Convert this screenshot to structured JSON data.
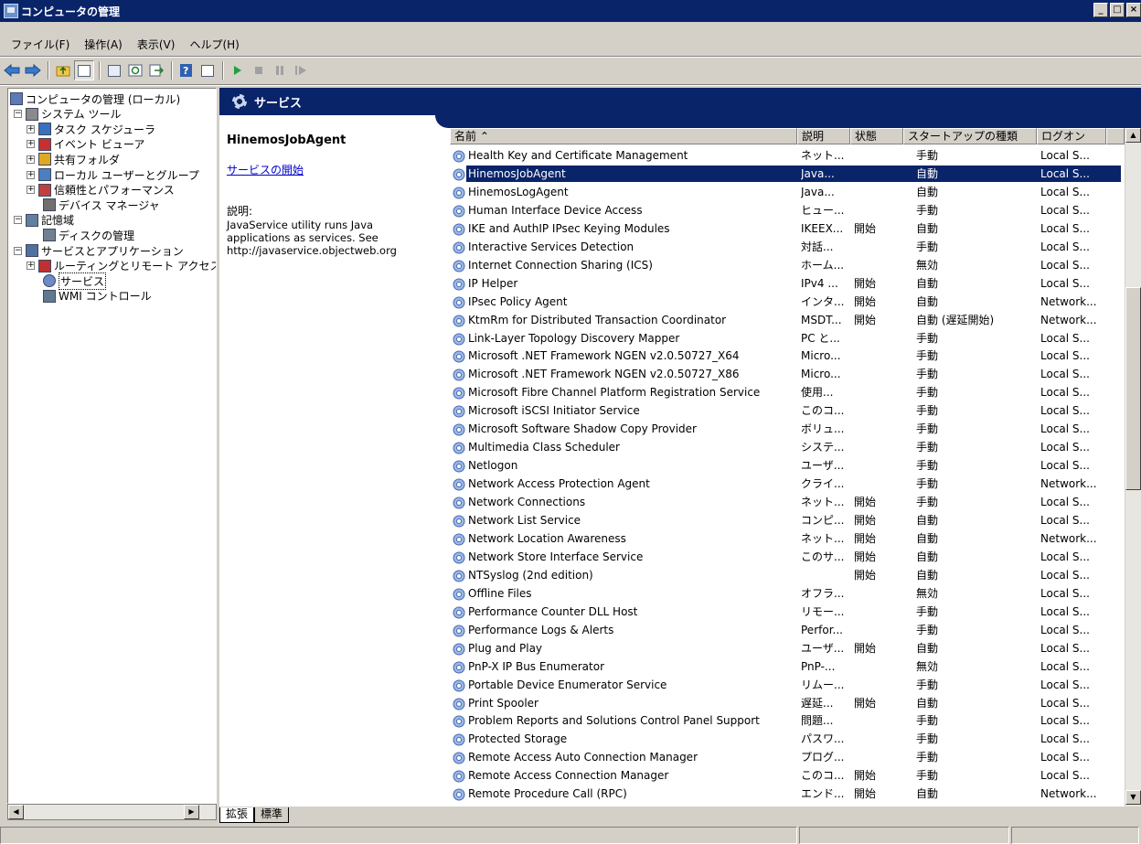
{
  "window": {
    "title": "コンピュータの管理"
  },
  "menu": [
    "ファイル(F)",
    "操作(A)",
    "表示(V)",
    "ヘルプ(H)"
  ],
  "tree": [
    {
      "label": "コンピュータの管理 (ローカル)",
      "level": 0,
      "expander": "",
      "icon": "computer-management-icon"
    },
    {
      "label": "システム ツール",
      "level": 1,
      "expander": "⊟",
      "icon": "tools-icon"
    },
    {
      "label": "タスク スケジューラ",
      "level": 2,
      "expander": "⊞",
      "icon": "clock-icon"
    },
    {
      "label": "イベント ビューア",
      "level": 2,
      "expander": "⊞",
      "icon": "event-viewer-icon"
    },
    {
      "label": "共有フォルダ",
      "level": 2,
      "expander": "⊞",
      "icon": "shared-folder-icon"
    },
    {
      "label": "ローカル ユーザーとグループ",
      "level": 2,
      "expander": "⊞",
      "icon": "users-icon"
    },
    {
      "label": "信頼性とパフォーマンス",
      "level": 2,
      "expander": "⊞",
      "icon": "performance-icon"
    },
    {
      "label": "デバイス マネージャ",
      "level": 3,
      "expander": "",
      "icon": "device-manager-icon"
    },
    {
      "label": "記憶域",
      "level": 1,
      "expander": "⊟",
      "icon": "storage-icon"
    },
    {
      "label": "ディスクの管理",
      "level": 3,
      "expander": "",
      "icon": "disk-icon"
    },
    {
      "label": "サービスとアプリケーション",
      "level": 1,
      "expander": "⊟",
      "icon": "services-apps-icon"
    },
    {
      "label": "ルーティングとリモート アクセス",
      "level": 2,
      "expander": "⊞",
      "icon": "routing-icon"
    },
    {
      "label": "サービス",
      "level": 3,
      "expander": "",
      "icon": "gear-icon",
      "selected": true
    },
    {
      "label": "WMI コントロール",
      "level": 3,
      "expander": "",
      "icon": "wmi-icon"
    }
  ],
  "header": {
    "title": "サービス"
  },
  "detail": {
    "name": "HinemosJobAgent",
    "start_link": "サービスの開始",
    "desc_label": "説明:",
    "desc_text": "JavaService utility runs Java applications as services. See http://javaservice.objectweb.org"
  },
  "columns": [
    "名前 ⌃",
    "説明",
    "状態",
    "スタートアップの種類",
    "ログオン"
  ],
  "services": [
    [
      "Health Key and Certificate Management",
      "ネット...",
      "",
      "手動",
      "Local S..."
    ],
    [
      "HinemosJobAgent",
      "Java...",
      "",
      "自動",
      "Local S..."
    ],
    [
      "HinemosLogAgent",
      "Java...",
      "",
      "自動",
      "Local S..."
    ],
    [
      "Human Interface Device Access",
      "ヒュー...",
      "",
      "手動",
      "Local S..."
    ],
    [
      "IKE and AuthIP IPsec Keying Modules",
      "IKEEX...",
      "開始",
      "自動",
      "Local S..."
    ],
    [
      "Interactive Services Detection",
      "対話...",
      "",
      "手動",
      "Local S..."
    ],
    [
      "Internet Connection Sharing (ICS)",
      "ホーム...",
      "",
      "無効",
      "Local S..."
    ],
    [
      "IP Helper",
      "IPv4 ...",
      "開始",
      "自動",
      "Local S..."
    ],
    [
      "IPsec Policy Agent",
      "インタ...",
      "開始",
      "自動",
      "Network..."
    ],
    [
      "KtmRm for Distributed Transaction Coordinator",
      "MSDT...",
      "開始",
      "自動 (遅延開始)",
      "Network..."
    ],
    [
      "Link-Layer Topology Discovery Mapper",
      "PC と...",
      "",
      "手動",
      "Local S..."
    ],
    [
      "Microsoft .NET Framework NGEN v2.0.50727_X64",
      "Micro...",
      "",
      "手動",
      "Local S..."
    ],
    [
      "Microsoft .NET Framework NGEN v2.0.50727_X86",
      "Micro...",
      "",
      "手動",
      "Local S..."
    ],
    [
      "Microsoft Fibre Channel Platform Registration Service",
      "使用...",
      "",
      "手動",
      "Local S..."
    ],
    [
      "Microsoft iSCSI Initiator Service",
      "このコ...",
      "",
      "手動",
      "Local S..."
    ],
    [
      "Microsoft Software Shadow Copy Provider",
      "ボリュ...",
      "",
      "手動",
      "Local S..."
    ],
    [
      "Multimedia Class Scheduler",
      "システ...",
      "",
      "手動",
      "Local S..."
    ],
    [
      "Netlogon",
      "ユーザ...",
      "",
      "手動",
      "Local S..."
    ],
    [
      "Network Access Protection Agent",
      "クライ...",
      "",
      "手動",
      "Network..."
    ],
    [
      "Network Connections",
      "ネット...",
      "開始",
      "手動",
      "Local S..."
    ],
    [
      "Network List Service",
      "コンピ...",
      "開始",
      "自動",
      "Local S..."
    ],
    [
      "Network Location Awareness",
      "ネット...",
      "開始",
      "自動",
      "Network..."
    ],
    [
      "Network Store Interface Service",
      "このサ...",
      "開始",
      "自動",
      "Local S..."
    ],
    [
      "NTSyslog (2nd edition)",
      "",
      "開始",
      "自動",
      "Local S..."
    ],
    [
      "Offline Files",
      "オフラ...",
      "",
      "無効",
      "Local S..."
    ],
    [
      "Performance Counter DLL Host",
      "リモー...",
      "",
      "手動",
      "Local S..."
    ],
    [
      "Performance Logs & Alerts",
      "Perfor...",
      "",
      "手動",
      "Local S..."
    ],
    [
      "Plug and Play",
      "ユーザ...",
      "開始",
      "自動",
      "Local S..."
    ],
    [
      "PnP-X IP Bus Enumerator",
      "PnP-...",
      "",
      "無効",
      "Local S..."
    ],
    [
      "Portable Device Enumerator Service",
      "リムー...",
      "",
      "手動",
      "Local S..."
    ],
    [
      "Print Spooler",
      "遅延...",
      "開始",
      "自動",
      "Local S..."
    ],
    [
      "Problem Reports and Solutions Control Panel Support",
      "問題...",
      "",
      "手動",
      "Local S..."
    ],
    [
      "Protected Storage",
      "パスワ...",
      "",
      "手動",
      "Local S..."
    ],
    [
      "Remote Access Auto Connection Manager",
      "プログ...",
      "",
      "手動",
      "Local S..."
    ],
    [
      "Remote Access Connection Manager",
      "このコ...",
      "開始",
      "手動",
      "Local S..."
    ],
    [
      "Remote Procedure Call (RPC)",
      "エンド...",
      "開始",
      "自動",
      "Network..."
    ]
  ],
  "selected_index": 1,
  "tabs": [
    "拡張",
    "標準"
  ]
}
